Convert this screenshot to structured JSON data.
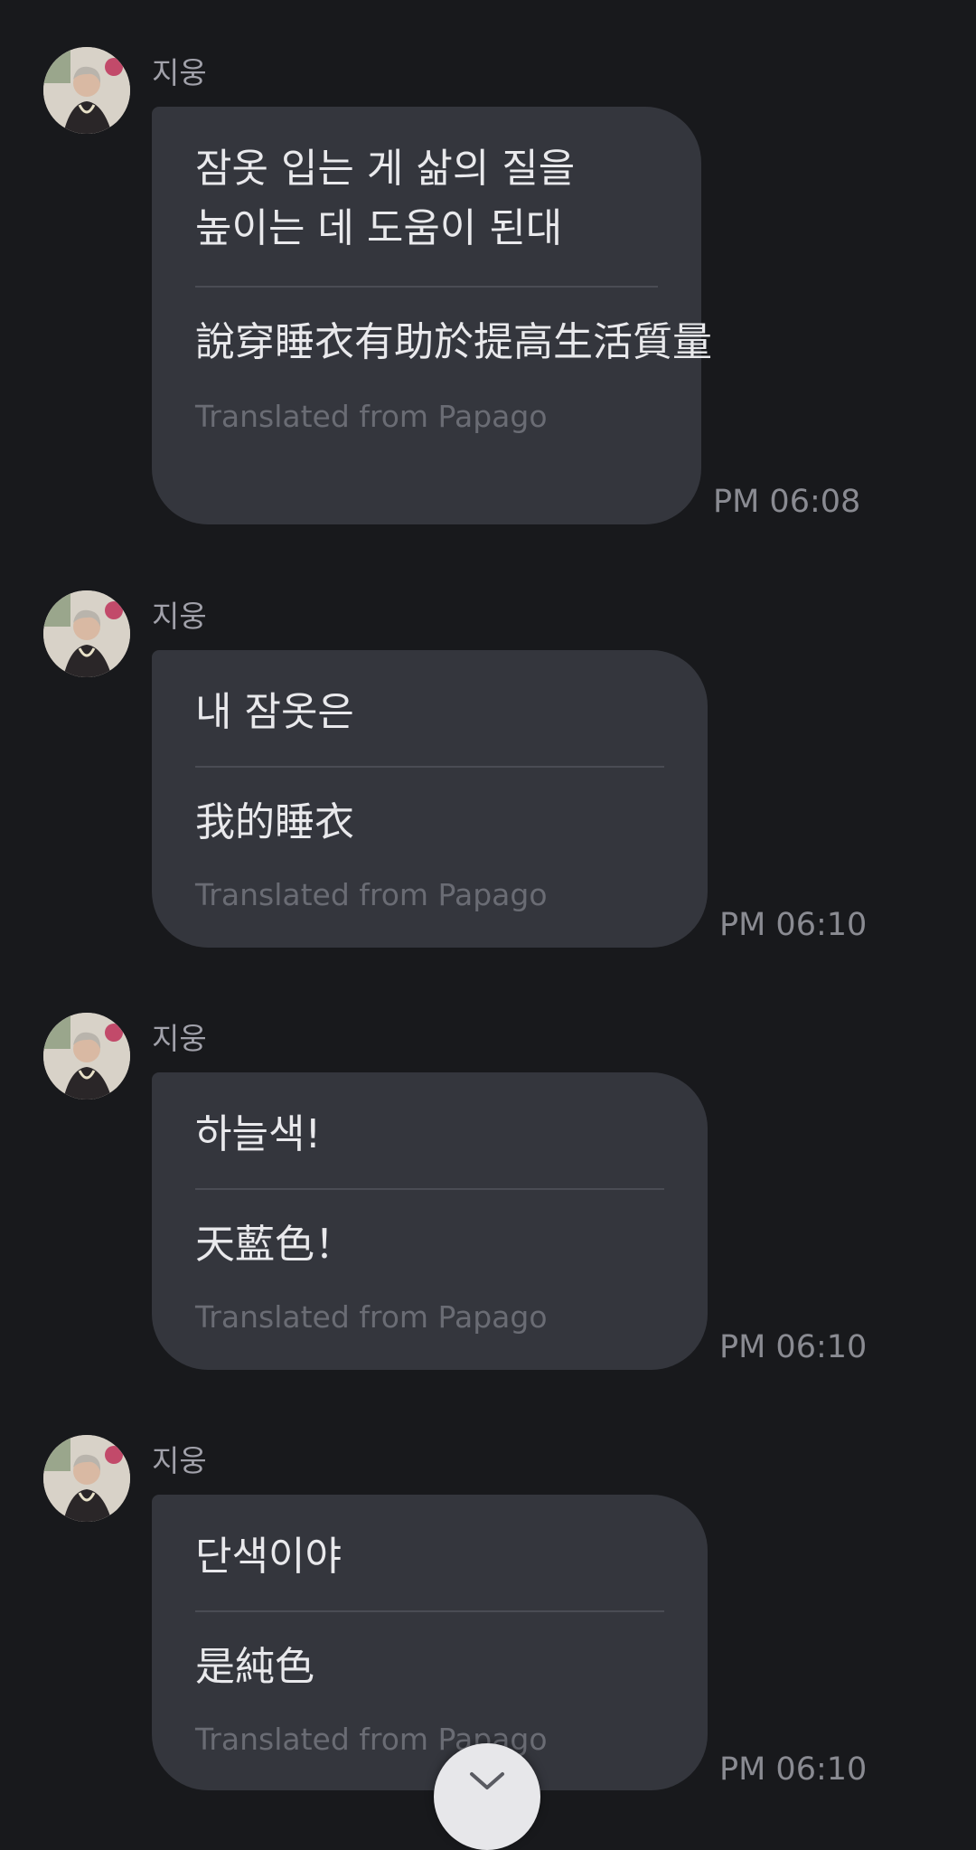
{
  "messages": [
    {
      "sender": "지웅",
      "original": "잠옷 입는 게 삶의 질을 높이는 데 도움이 된대",
      "translated": "說穿睡衣有助於提高生活質量",
      "via": "Translated from Papago",
      "time": "PM 06:08"
    },
    {
      "sender": "지웅",
      "original": "내 잠옷은",
      "translated": "我的睡衣",
      "via": "Translated from Papago",
      "time": "PM 06:10"
    },
    {
      "sender": "지웅",
      "original": "하늘색!",
      "translated": "天藍色！",
      "via": "Translated from Papago",
      "time": "PM 06:10"
    },
    {
      "sender": "지웅",
      "original": "단색이야",
      "translated": "是純色",
      "via": "Translated from Papago",
      "time": "PM 06:10"
    }
  ],
  "icons": {
    "avatar": "profile-photo",
    "scroll_button": "chevron-down-icon"
  },
  "colors": {
    "background": "#18191c",
    "bubble": "#34363d",
    "text": "#e9e9ec",
    "muted": "#8a8b92"
  }
}
